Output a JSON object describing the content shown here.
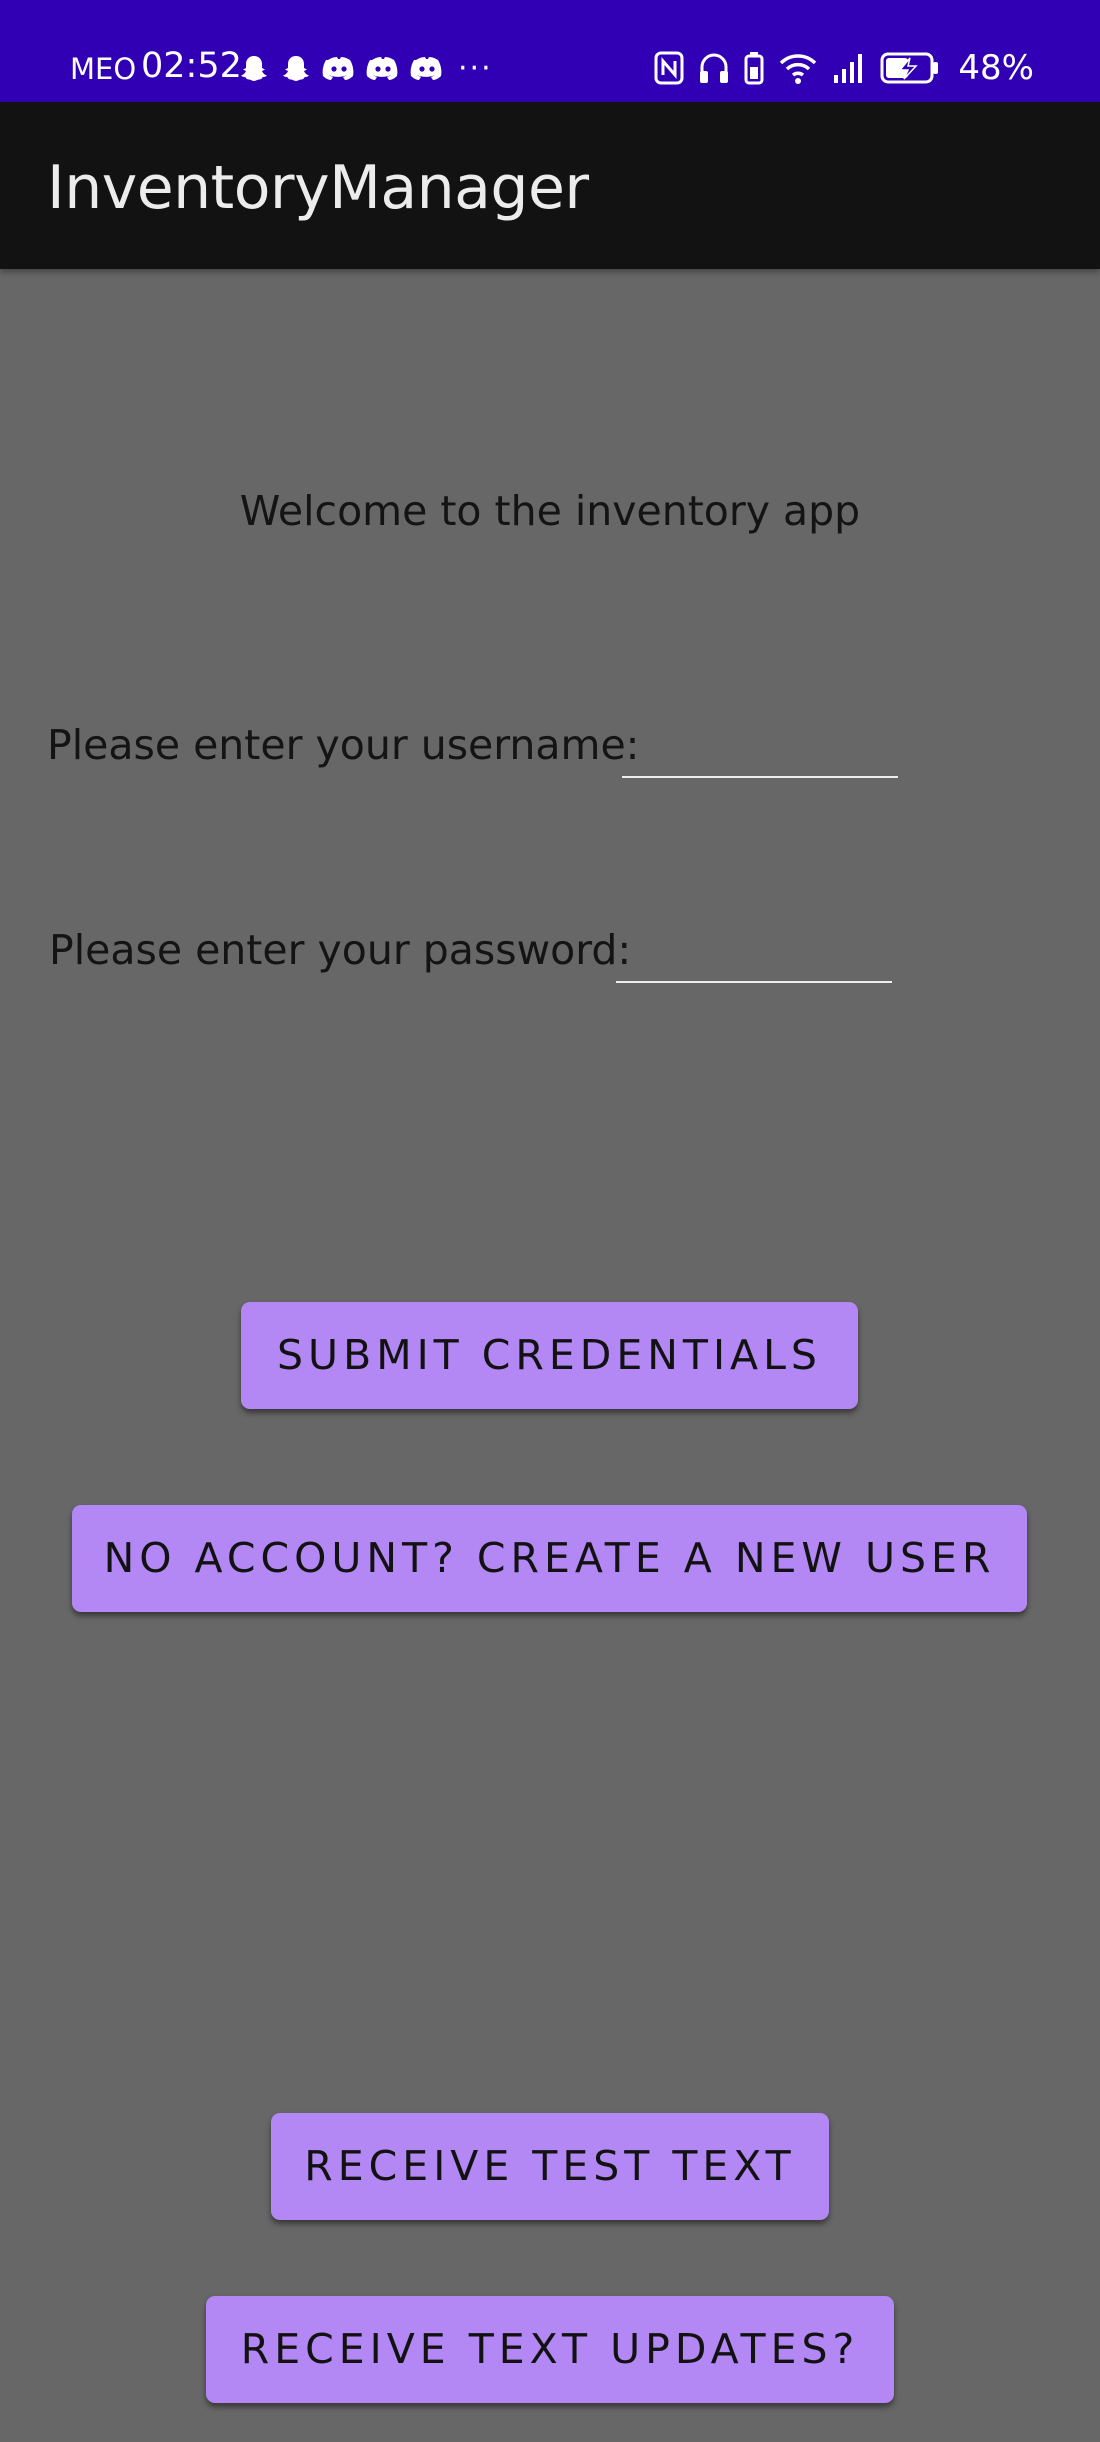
{
  "status_bar": {
    "carrier": "MEO",
    "time": "02:52",
    "notification_icons": [
      "snapchat-icon",
      "snapchat-icon",
      "discord-icon",
      "discord-icon",
      "discord-icon"
    ],
    "more_indicator": "···",
    "battery_percent": "48%",
    "background_color": "#3200b4"
  },
  "app_bar": {
    "title": "InventoryManager",
    "background_color": "#121212"
  },
  "login": {
    "welcome_text": "Welcome to the inventory app",
    "username_label": "Please enter your username:",
    "username_value": "",
    "password_label": "Please enter your password:",
    "password_value": ""
  },
  "buttons": {
    "submit": "SUBMIT CREDENTIALS",
    "create_user": "NO ACCOUNT? CREATE A NEW USER",
    "receive_test": "RECEIVE TEST TEXT",
    "receive_updates": "RECEIVE TEXT UPDATES?"
  },
  "colors": {
    "page_background": "#676767",
    "button_background": "#b388f4"
  }
}
